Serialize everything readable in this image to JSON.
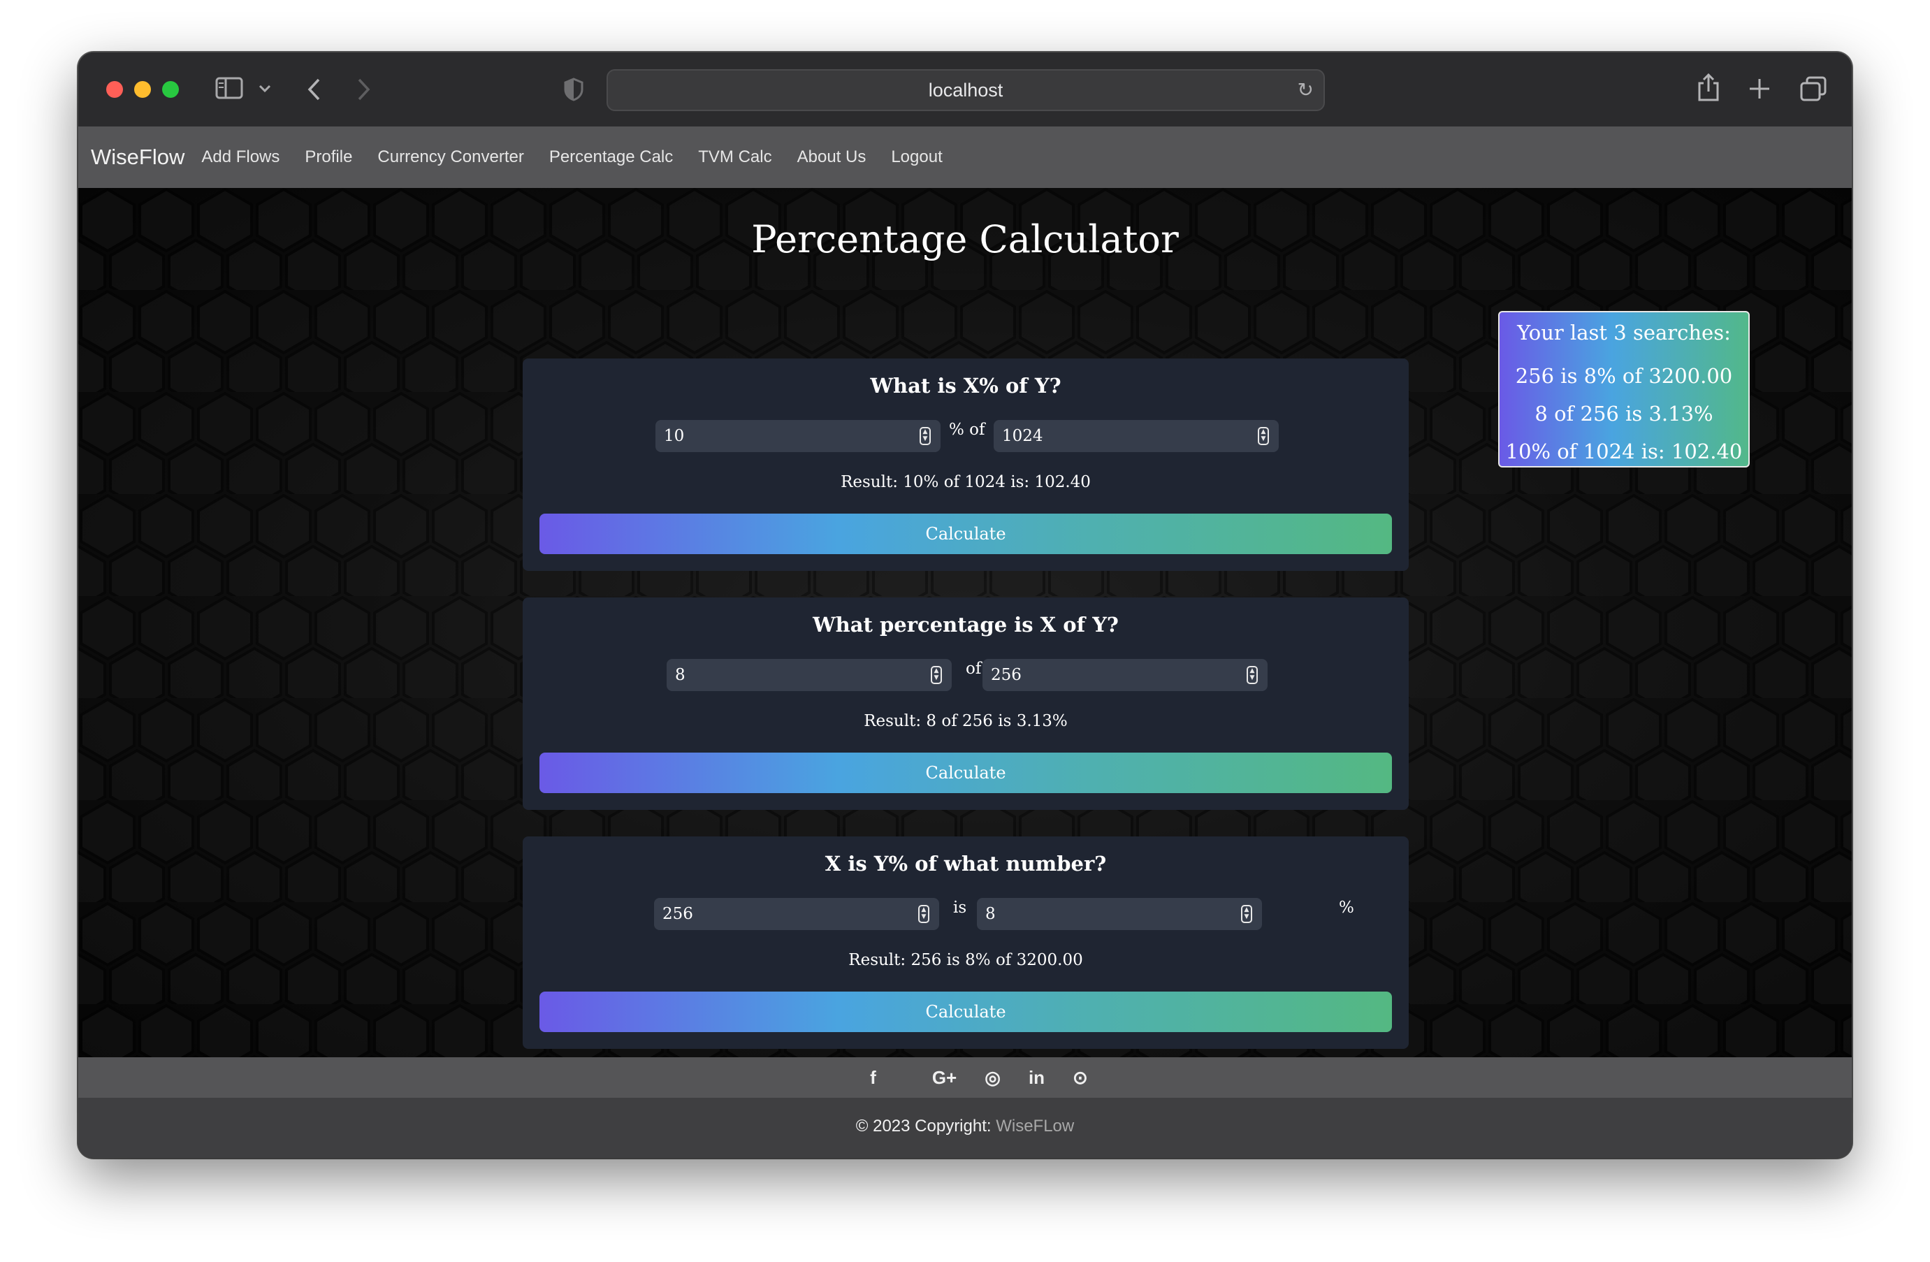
{
  "browser": {
    "url": "localhost"
  },
  "nav": {
    "brand": "WiseFlow",
    "links": [
      "Add Flows",
      "Profile",
      "Currency Converter",
      "Percentage Calc",
      "TVM Calc",
      "About Us",
      "Logout"
    ]
  },
  "page": {
    "title": "Percentage Calculator"
  },
  "calculators": [
    {
      "title": "What is X%% of Y?",
      "input1": "10",
      "separator1": "% of",
      "input2": "1024",
      "separator2": "",
      "result": "Result: 10% of 1024 is: 102.40",
      "button": "Calculate"
    },
    {
      "title": "What percentage is X of Y?",
      "input1": "8",
      "separator1": "of",
      "input2": "256",
      "separator2": "",
      "result": "Result: 8 of 256 is 3.13%",
      "button": "Calculate"
    },
    {
      "title": "X is Y% of what number?",
      "input1": "256",
      "separator1": "is",
      "input2": "8",
      "separator2": "%",
      "result": "Result: 256 is 8% of 3200.00",
      "button": "Calculate"
    }
  ],
  "history": {
    "title": "Your last 3 searches:",
    "items": [
      "256 is 8% of 3200.00",
      "8 of 256 is 3.13%",
      "10% of 1024 is: 102.40"
    ]
  },
  "footer": {
    "social_icons": [
      "apple-icon",
      "facebook-icon",
      "twitter-icon",
      "google-plus-icon",
      "instagram-icon",
      "linkedin-icon",
      "github-icon"
    ],
    "social_glyphs": [
      "",
      "f",
      "",
      "G+",
      "◎",
      "in",
      "⊙"
    ],
    "copyright_prefix": "© 2023 Copyright:",
    "copyright_brand": "WiseFLow"
  }
}
